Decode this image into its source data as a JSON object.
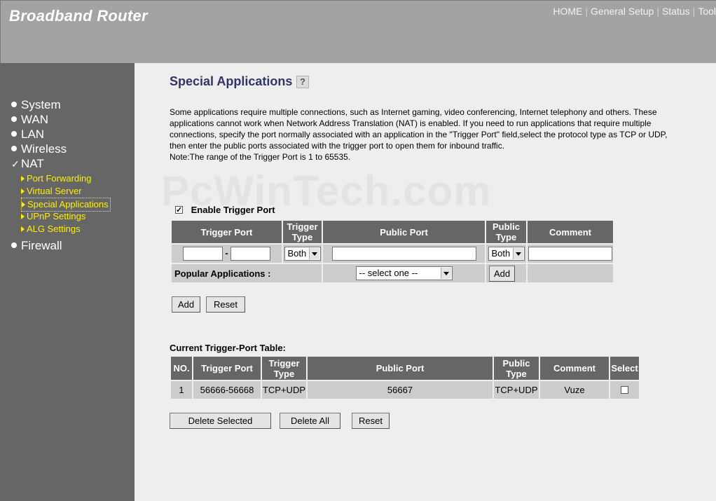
{
  "header": {
    "brand": "Broadband Router",
    "nav": [
      "HOME",
      "General Setup",
      "Status",
      "Tool"
    ]
  },
  "sidebar": {
    "items": [
      {
        "label": "System",
        "marker": "bullet"
      },
      {
        "label": "WAN",
        "marker": "bullet"
      },
      {
        "label": "LAN",
        "marker": "bullet"
      },
      {
        "label": "Wireless",
        "marker": "bullet"
      },
      {
        "label": "NAT",
        "marker": "check"
      },
      {
        "label": "Firewall",
        "marker": "bullet"
      }
    ],
    "nat_sub": [
      "Port Forwarding",
      "Virtual Server",
      "Special Applications",
      "UPnP Settings",
      "ALG Settings"
    ],
    "active_sub": "Special Applications"
  },
  "main": {
    "title": "Special Applications",
    "intro": "Some applications require multiple connections, such as Internet gaming, video conferencing, Internet telephony and others. These applications cannot work when Network Address Translation (NAT) is enabled. If you need to run applications that require multiple connections, specify the port normally associated with an application in the \"Trigger Port\" field,select the protocol type as TCP or UDP, then enter the public ports associated with the trigger port to open them for inbound traffic.",
    "note": "Note:The range of the Trigger Port is 1 to 65535.",
    "watermark": "PcWinTech.com",
    "enable_label": "Enable Trigger Port",
    "enable_checked": true
  },
  "form": {
    "headers": {
      "trigger_port": "Trigger Port",
      "trigger_type_1": "Trigger",
      "trigger_type_2": "Type",
      "public_port": "Public Port",
      "public_type_1": "Public",
      "public_type_2": "Type",
      "comment": "Comment"
    },
    "range_dash": "-",
    "trigger_type_value": "Both",
    "public_type_value": "Both",
    "popular_label": "Popular Applications :",
    "popular_select": "-- select one --",
    "popular_add": "Add",
    "add_label": "Add",
    "reset_label": "Reset"
  },
  "current": {
    "title": "Current Trigger-Port Table:",
    "headers": {
      "no": "NO.",
      "trigger_port": "Trigger Port",
      "trigger_type_1": "Trigger",
      "trigger_type_2": "Type",
      "public_port": "Public Port",
      "public_type_1": "Public",
      "public_type_2": "Type",
      "comment": "Comment",
      "select": "Select"
    },
    "rows": [
      {
        "no": "1",
        "trigger_port": "56666-56668",
        "trigger_type": "TCP+UDP",
        "public_port": "56667",
        "public_type": "TCP+UDP",
        "comment": "Vuze",
        "selected": false
      }
    ],
    "delete_selected": "Delete Selected",
    "delete_all": "Delete All",
    "reset": "Reset"
  },
  "colors": {
    "header_bg": "#a3a3a3",
    "sidebar_bg": "#666666",
    "submenu": "#ffee00",
    "table_header": "#666666",
    "table_cell": "#cccccc",
    "title": "#333366"
  }
}
